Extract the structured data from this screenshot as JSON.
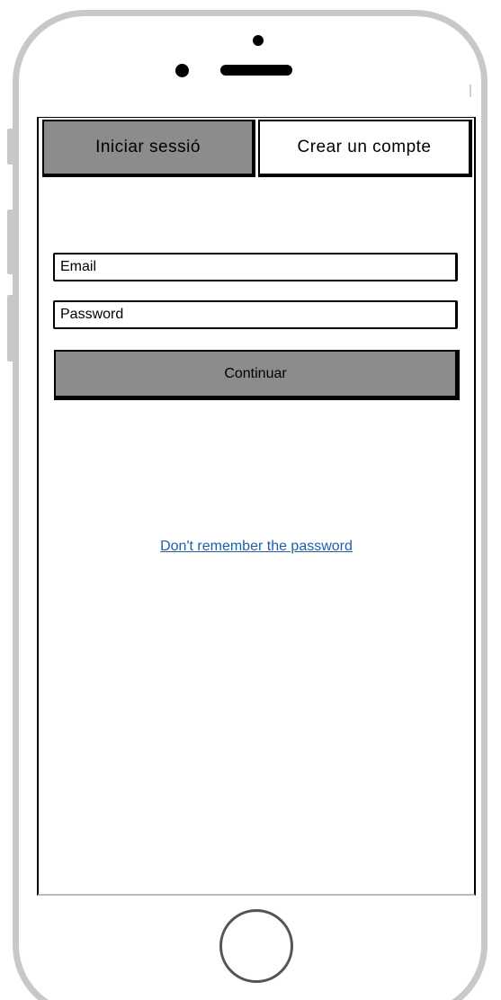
{
  "tabs": {
    "login_label": "Iniciar sessió",
    "signup_label": "Crear un compte",
    "active": "login"
  },
  "form": {
    "email_placeholder": "Email",
    "password_placeholder": "Password",
    "continue_label": "Continuar"
  },
  "forgot_password_label": "Don't remember the password",
  "colors": {
    "active_tab": "#8c8c8c",
    "button": "#8c8c8c",
    "link": "#1f5fa8",
    "phone_frame": "#c8c8c8"
  },
  "icons": {
    "camera": "front-camera-icon",
    "speaker": "speaker-icon",
    "home": "home-button-icon"
  }
}
